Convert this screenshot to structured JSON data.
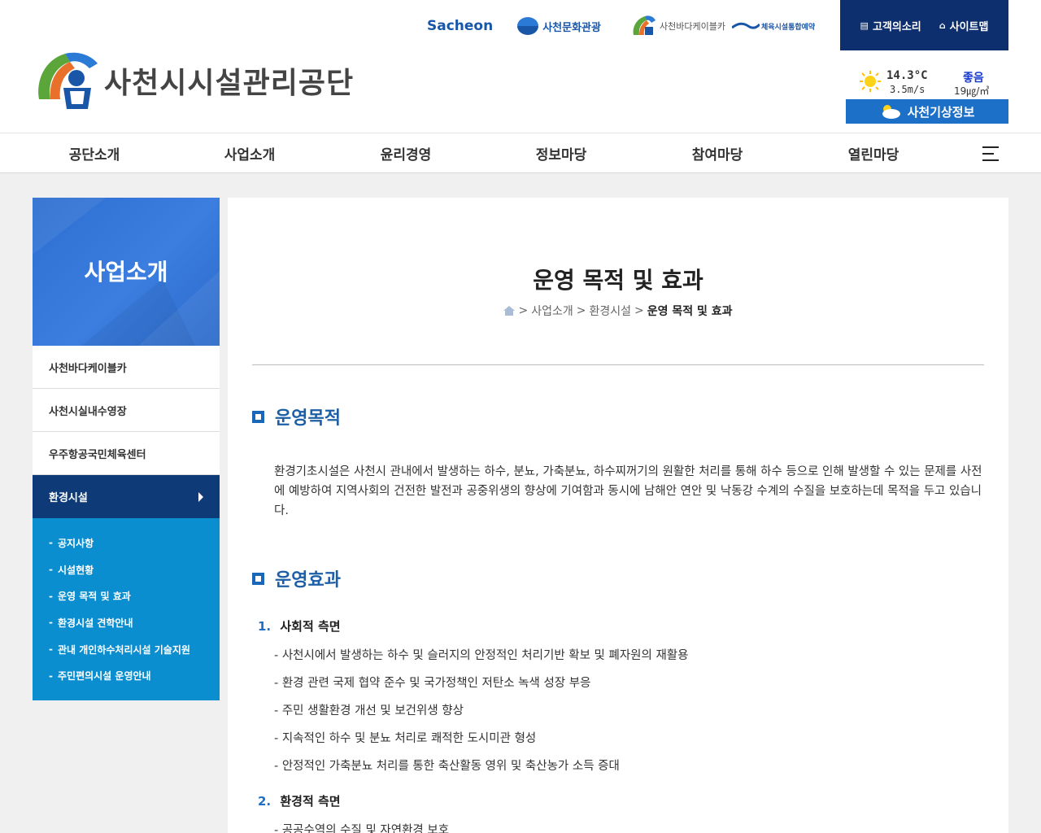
{
  "header": {
    "logo_text": "사천시시설관리공단",
    "top_links": {
      "sachon": "Sacheon",
      "culture": "사천문화관광",
      "cable": "사천바다케이블카",
      "sports": "체육시설통합예약"
    },
    "util": {
      "voice": "고객의소리",
      "sitemap": "사이트맵"
    },
    "weather": {
      "temperature": "14.3°C",
      "wind": "3.5m/s",
      "air_status": "좋음",
      "air_value": "19㎍/㎥",
      "button": "사천기상정보"
    }
  },
  "nav": {
    "items": [
      "공단소개",
      "사업소개",
      "윤리경영",
      "정보마당",
      "참여마당",
      "열린마당"
    ]
  },
  "sidebar": {
    "title": "사업소개",
    "items": [
      "사천바다케이블카",
      "사천시실내수영장",
      "우주항공국민체육센터",
      "환경시설"
    ],
    "sub_items": [
      "공지사항",
      "시설현황",
      "운영 목적 및 효과",
      "환경시설 견학안내",
      "관내 개인하수처리시설 기술지원",
      "주민편의시설 운영안내"
    ]
  },
  "content": {
    "title": "운영 목적 및 효과",
    "breadcrumb": {
      "sep": ">",
      "level1": "사업소개",
      "level2": "환경시설",
      "current": "운영 목적 및 효과"
    },
    "section1": {
      "heading": "운영목적",
      "text": "환경기초시설은 사천시 관내에서 발생하는 하수, 분뇨, 가축분뇨, 하수찌꺼기의 원활한 처리를 통해 하수 등으로 인해 발생할 수 있는 문제를 사전에 예방하여 지역사회의 건전한 발전과 공중위생의 향상에 기여함과 동시에 남해안 연안 및 낙동강 수계의 수질을 보호하는데 목적을 두고 있습니다."
    },
    "section2": {
      "heading": "운영효과",
      "sub1": {
        "num": "1.",
        "title": "사회적 측면",
        "bullets": [
          "- 사천시에서 발생하는 하수 및 슬러지의 안정적인 처리기반 확보 및 폐자원의 재활용",
          "- 환경 관련 국제 협약 준수 및 국가정책인 저탄소 녹색 성장 부응",
          "- 주민 생활환경 개선 및 보건위생 향상",
          "- 지속적인 하수 및 분뇨 처리로 쾌적한 도시미관 형성",
          "- 안정적인 가축분뇨 처리를 통한 축산활동 영위 및 축산농가 소득 증대"
        ]
      },
      "sub2": {
        "num": "2.",
        "title": "환경적 측면",
        "bullets": [
          "- 공공수역의 수질 및 자연환경 보호"
        ]
      }
    }
  }
}
